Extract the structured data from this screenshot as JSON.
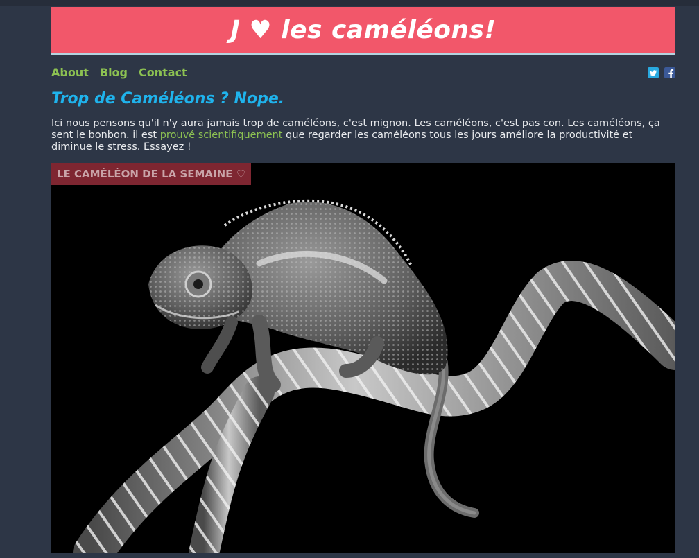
{
  "header": {
    "title": "J ♥ les caméléons!"
  },
  "nav": {
    "items": [
      {
        "label": "About"
      },
      {
        "label": "Blog"
      },
      {
        "label": "Contact"
      }
    ]
  },
  "social": {
    "icons": [
      "twitter-icon",
      "facebook-icon"
    ],
    "twitter_color": "#29a9e0",
    "facebook_color": "#3b5998"
  },
  "article": {
    "headline": "Trop de Caméléons ? Nope.",
    "body_before_link": "Ici nous pensons qu'il n'y aura jamais trop de caméléons, c'est mignon. Les caméléons, c'est pas con. Les caméléons, ça sent le bonbon. il est ",
    "link_text": "prouvé scientifiquement ",
    "body_after_link": "que regarder les caméléons tous les jours améliore la productivité et diminue le stress. Essayez !"
  },
  "feature": {
    "tag": "LE CAMÉLÉON DE LA SEMAINE ♡"
  },
  "colors": {
    "background": "#2d3646",
    "banner": "#f2576a",
    "banner_border": "#b4d4e0",
    "nav_link": "#8cc152",
    "headline": "#1fb3ec",
    "tag_bg": "#7e2631"
  }
}
